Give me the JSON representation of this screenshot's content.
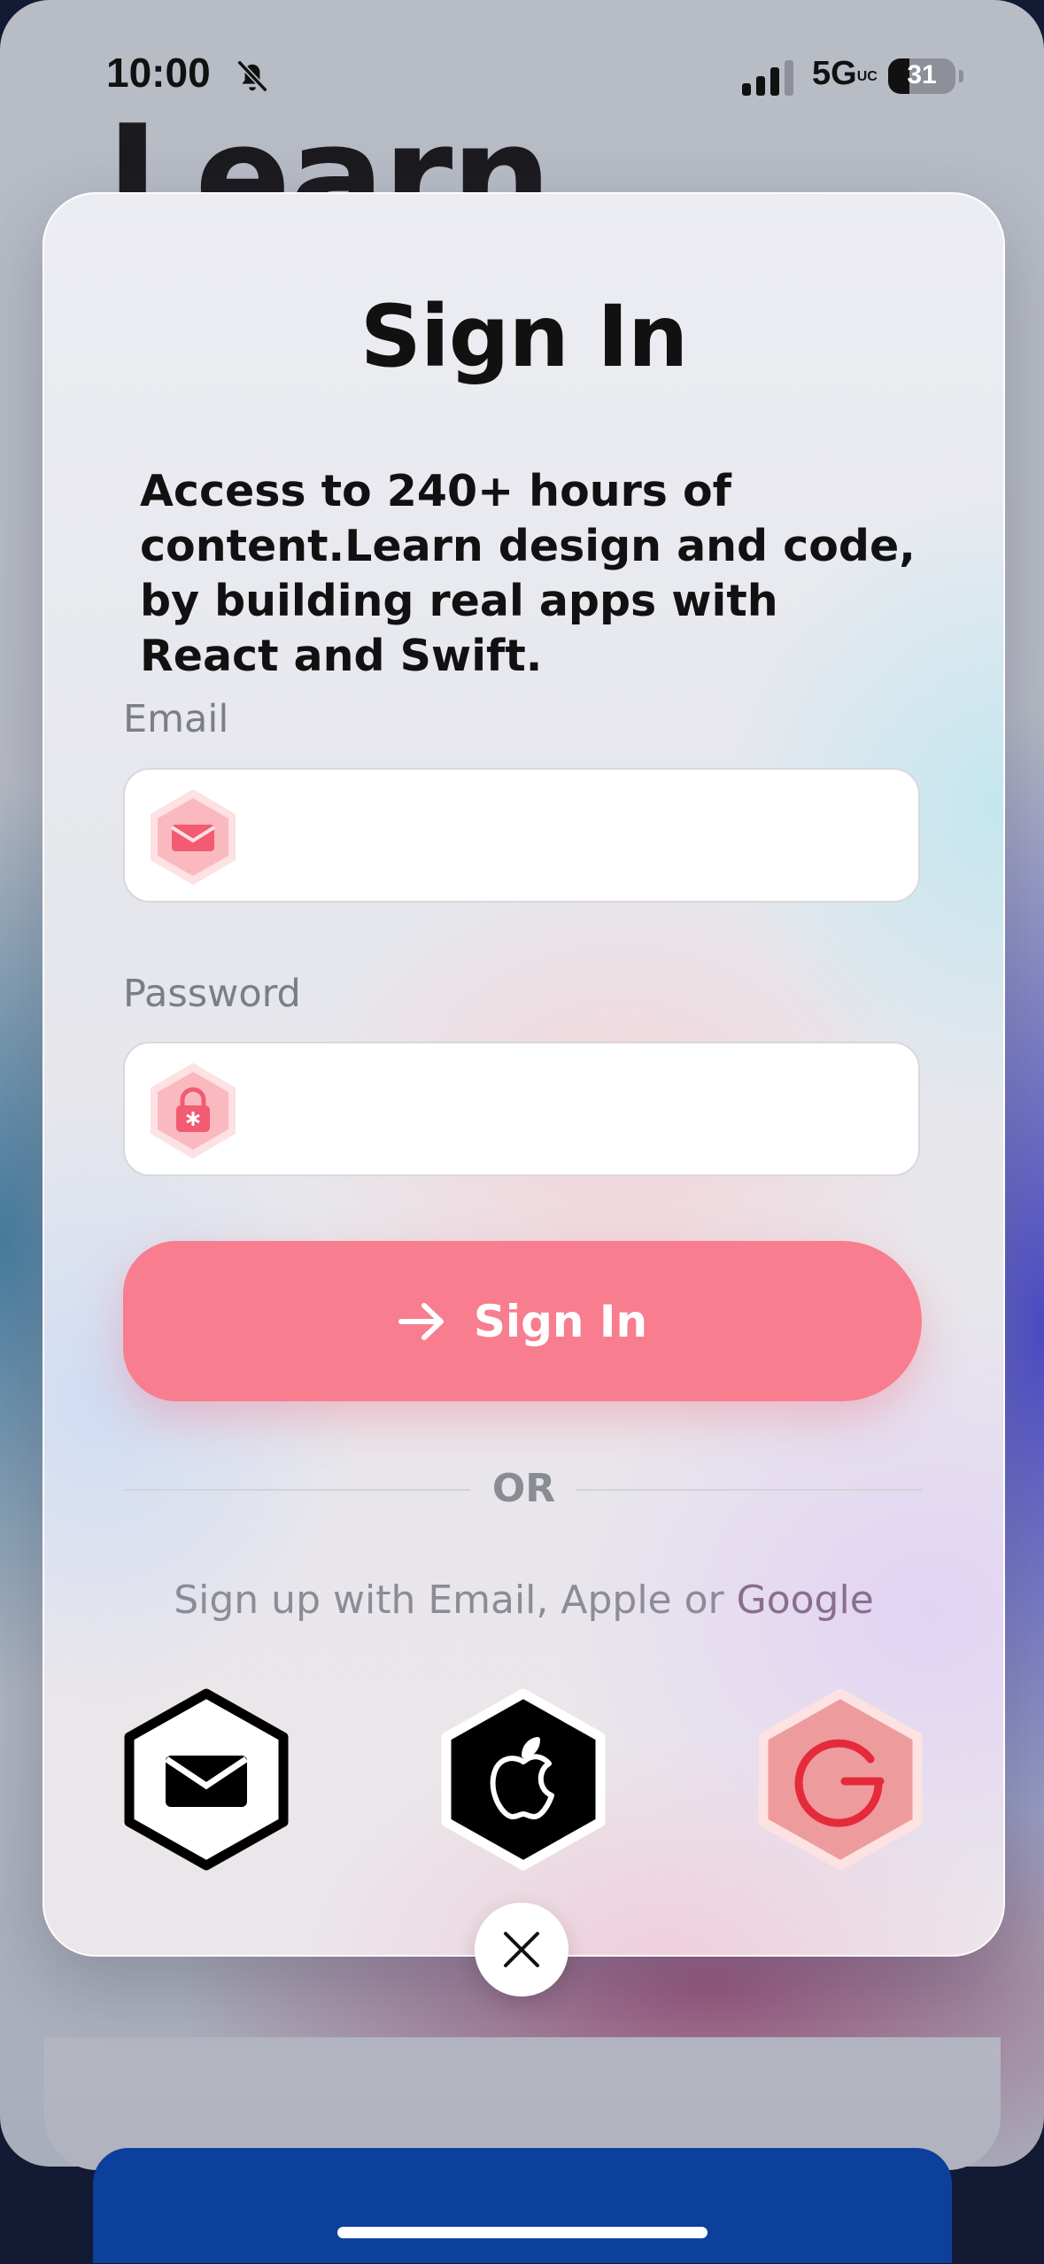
{
  "status_bar": {
    "time": "10:00",
    "network": "5G",
    "network_suffix": "UC",
    "battery": "31"
  },
  "background": {
    "title": "Learn"
  },
  "modal": {
    "title": "Sign In",
    "description": "Access to 240+ hours of content.Learn design and code, by building real apps with React and Swift.",
    "email_label": "Email",
    "email_value": "",
    "password_label": "Password",
    "password_value": "",
    "signin_button": "Sign In",
    "or_text": "OR",
    "signup_prefix": "Sign up with Email, Apple or ",
    "signup_google": "Google",
    "social": [
      "mail-icon",
      "apple-icon",
      "google-icon"
    ]
  },
  "colors": {
    "accent": "#f77d8f",
    "apple": "#000000",
    "google": "#ee9b9e"
  }
}
